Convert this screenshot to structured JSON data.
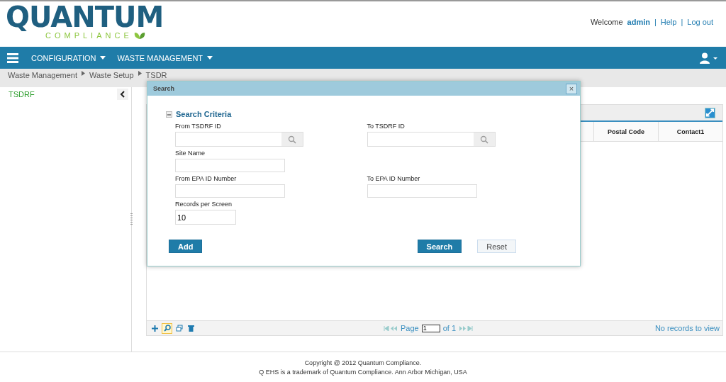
{
  "logo": {
    "name": "QUANTUM",
    "tagline": "COMPLIANCE"
  },
  "user_links": {
    "welcome": "Welcome",
    "user": "admin",
    "separator_1": "|",
    "help": "Help",
    "separator_2": "|",
    "logout": "Log out"
  },
  "nav": {
    "items": [
      {
        "label": "CONFIGURATION"
      },
      {
        "label": "WASTE MANAGEMENT"
      }
    ]
  },
  "breadcrumb": [
    "Waste Management",
    "Waste Setup",
    "TSDR"
  ],
  "sidebar": {
    "items": [
      {
        "label": "TSDRF",
        "selected": true
      }
    ]
  },
  "grid": {
    "columns": [
      "Postal Code",
      "Contact1"
    ],
    "toolbar": [
      {
        "kind": "add",
        "selected": false
      },
      {
        "kind": "search",
        "selected": true
      },
      {
        "kind": "copy",
        "selected": false
      },
      {
        "kind": "delete",
        "selected": false
      }
    ],
    "pager": {
      "page_label": "Page",
      "page": "1",
      "of_label": "of 1"
    },
    "status": "No records to view"
  },
  "dialog": {
    "title": "Search",
    "close": "×",
    "section": "Search Criteria",
    "expanded": true,
    "rows": [
      {
        "fields": [
          {
            "label": "From TSDRF ID",
            "kind": "lookup"
          },
          {
            "label": "To TSDRF ID",
            "kind": "lookup"
          }
        ]
      },
      {
        "fields": [
          {
            "label": "Site Name",
            "kind": "text"
          }
        ]
      },
      {
        "fields": [
          {
            "label": "From EPA ID Number",
            "kind": "text"
          },
          {
            "label": "To EPA ID Number",
            "kind": "text"
          }
        ]
      },
      {
        "fields": [
          {
            "label": "Records per Screen",
            "kind": "small",
            "value": "10"
          }
        ]
      }
    ],
    "buttons": [
      {
        "label": "Add",
        "kind": "primary"
      },
      {
        "label": "Search",
        "kind": "primary"
      },
      {
        "label": "Reset",
        "kind": "secondary"
      }
    ]
  },
  "footer": [
    "Copyright @ 2012 Quantum Compliance.",
    "Q EHS is a trademark of Quantum Compliance. Ann Arbor Michigan, USA"
  ]
}
